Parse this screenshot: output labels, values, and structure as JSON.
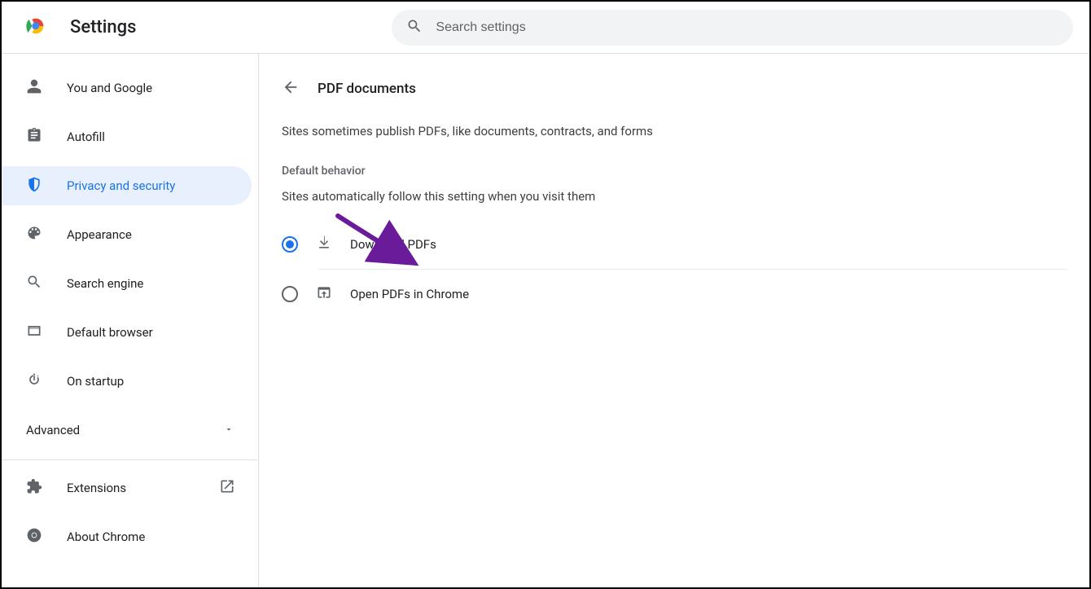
{
  "header": {
    "app_title": "Settings",
    "search_placeholder": "Search settings"
  },
  "sidebar": {
    "items": [
      {
        "label": "You and Google",
        "icon": "person-icon"
      },
      {
        "label": "Autofill",
        "icon": "clipboard-icon"
      },
      {
        "label": "Privacy and security",
        "icon": "shield-icon"
      },
      {
        "label": "Appearance",
        "icon": "palette-icon"
      },
      {
        "label": "Search engine",
        "icon": "search-icon"
      },
      {
        "label": "Default browser",
        "icon": "browser-icon"
      },
      {
        "label": "On startup",
        "icon": "power-icon"
      }
    ],
    "advanced_label": "Advanced",
    "extensions_label": "Extensions",
    "about_label": "About Chrome"
  },
  "main": {
    "page_title": "PDF documents",
    "description": "Sites sometimes publish PDFs, like documents, contracts, and forms",
    "section_title": "Default behavior",
    "section_sub": "Sites automatically follow this setting when you visit them",
    "options": [
      {
        "label": "Download PDFs",
        "selected": true
      },
      {
        "label": "Open PDFs in Chrome",
        "selected": false
      }
    ]
  }
}
